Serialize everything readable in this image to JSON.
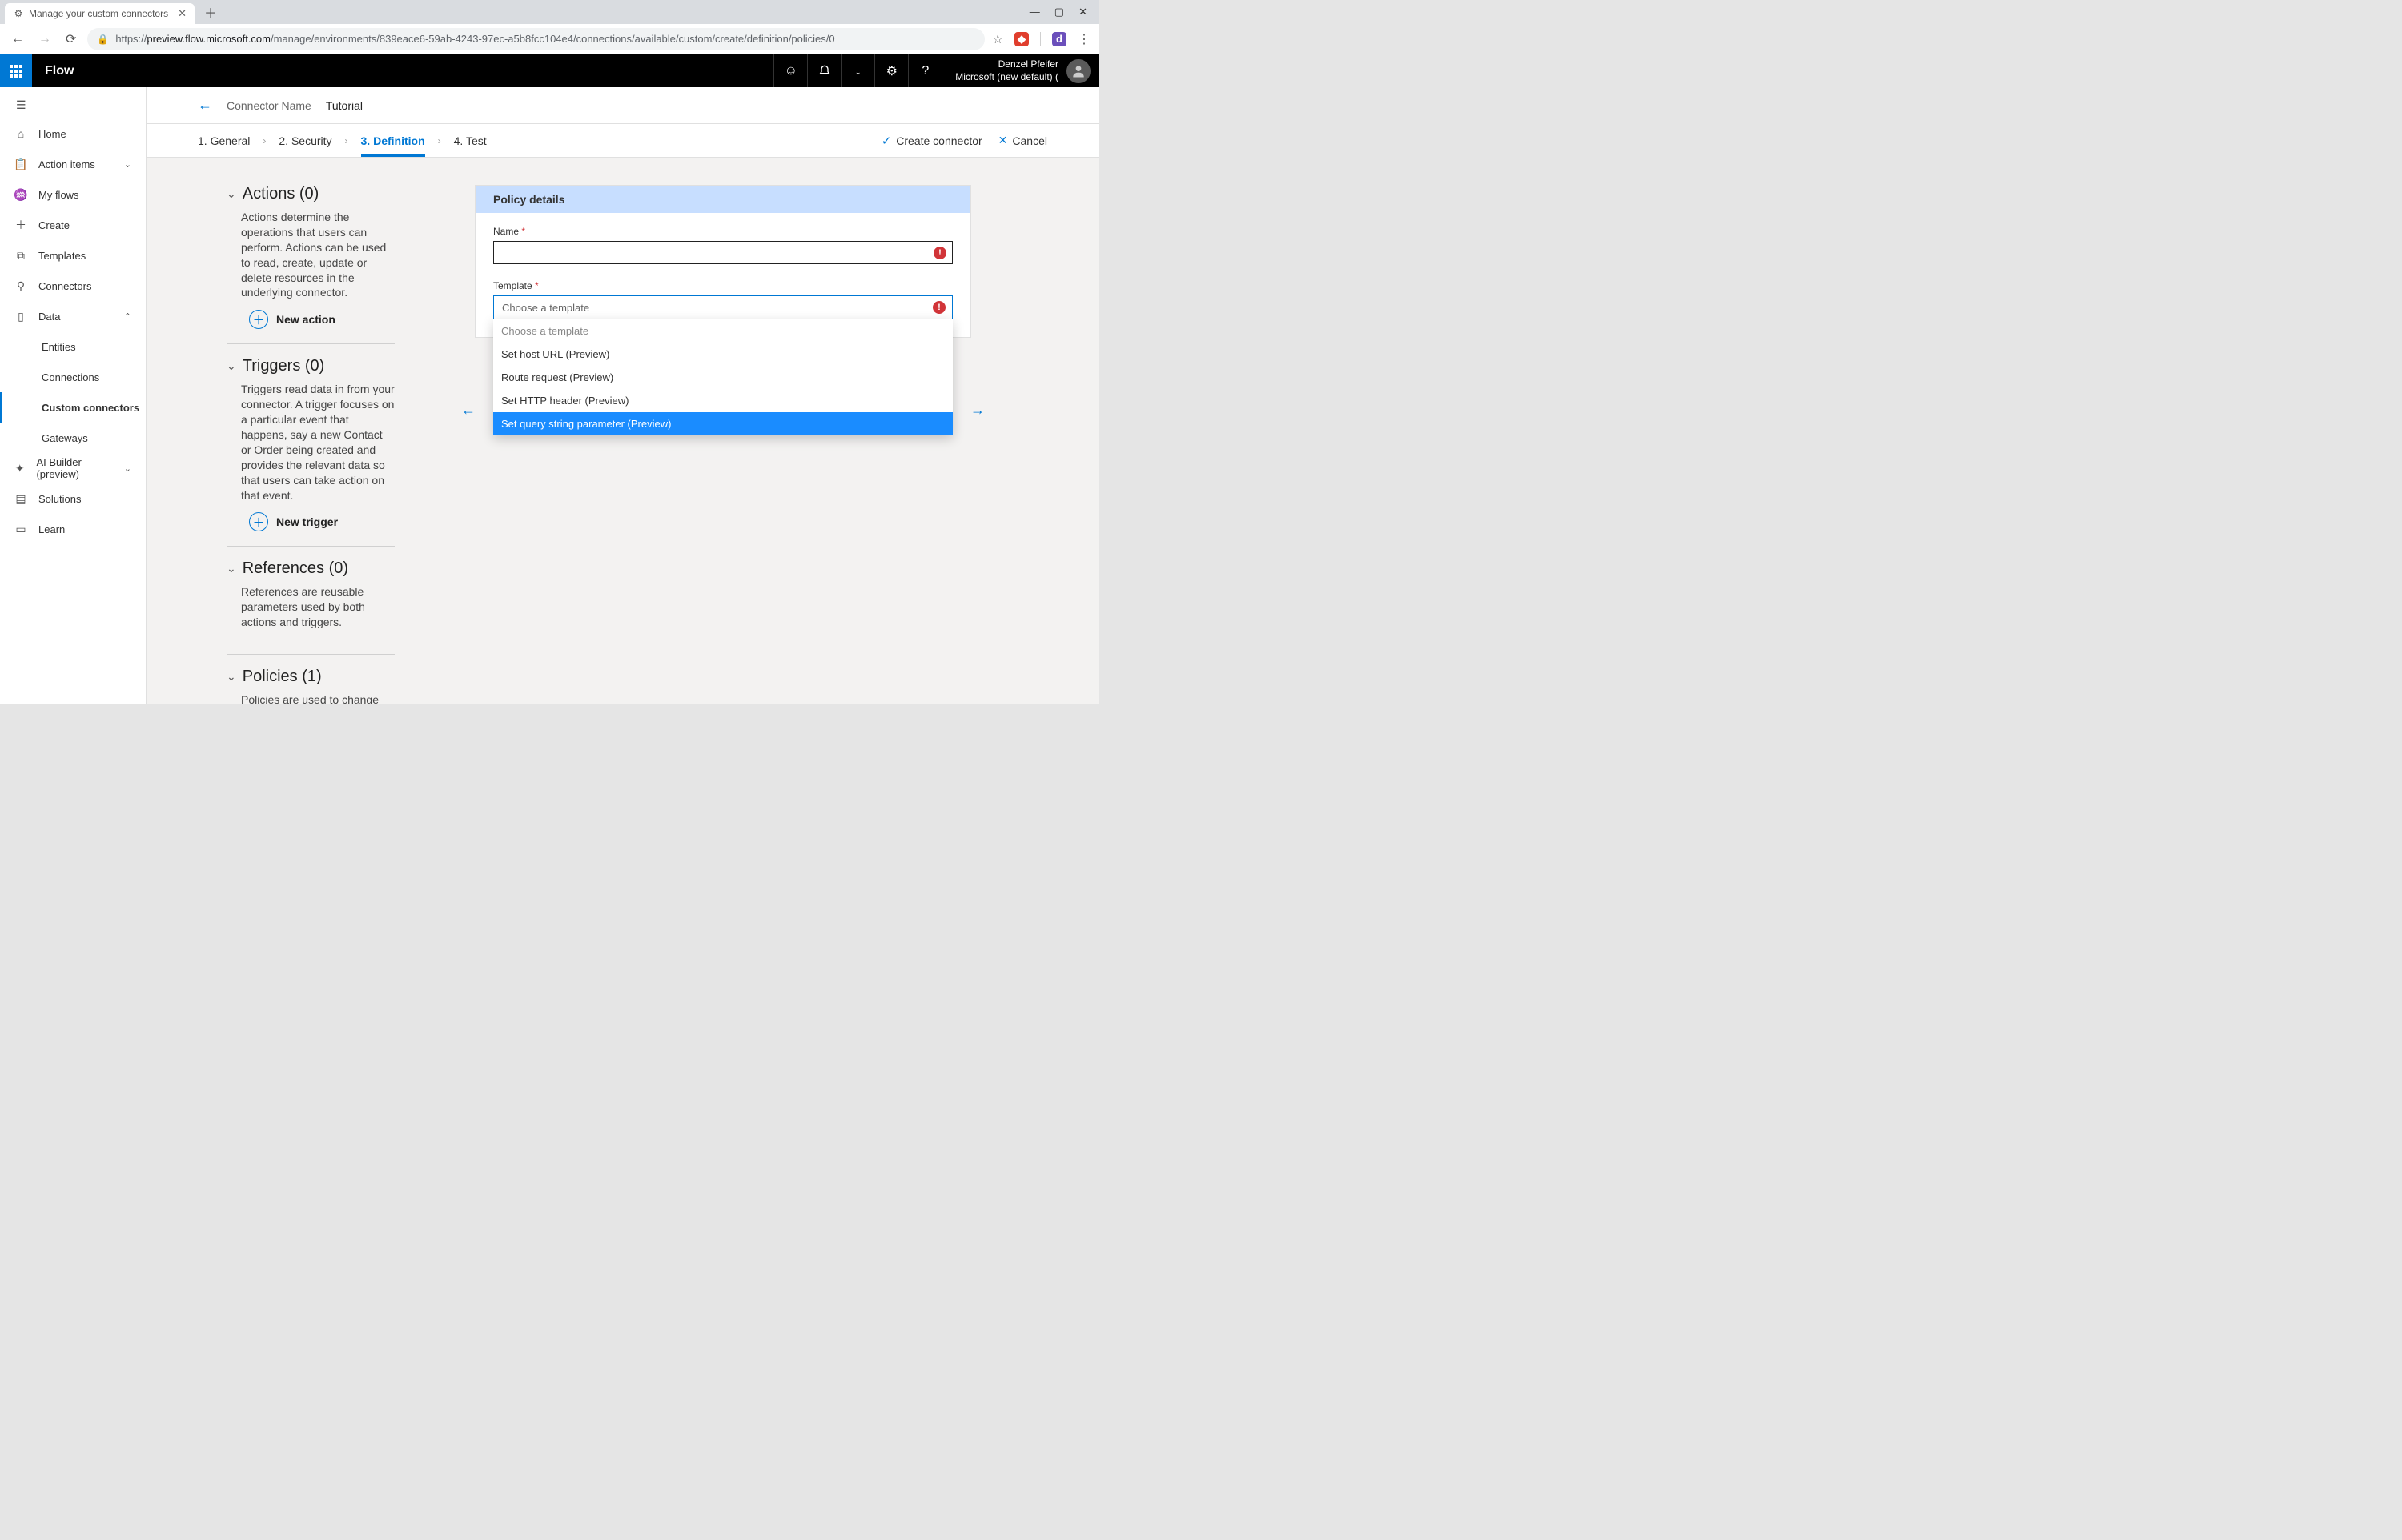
{
  "browser": {
    "tab_title": "Manage your custom connectors",
    "url_prefix": "https://",
    "url_host": "preview.flow.microsoft.com",
    "url_path": "/manage/environments/839eace6-59ab-4243-97ec-a5b8fcc104e4/connections/available/custom/create/definition/policies/0"
  },
  "app": {
    "name": "Flow",
    "user_name": "Denzel Pfeifer",
    "tenant": "Microsoft (new default) ("
  },
  "sidebar": {
    "items": [
      {
        "label": "Home"
      },
      {
        "label": "Action items"
      },
      {
        "label": "My flows"
      },
      {
        "label": "Create"
      },
      {
        "label": "Templates"
      },
      {
        "label": "Connectors"
      },
      {
        "label": "Data"
      }
    ],
    "data_children": [
      {
        "label": "Entities"
      },
      {
        "label": "Connections"
      },
      {
        "label": "Custom connectors"
      },
      {
        "label": "Gateways"
      }
    ],
    "tail": [
      {
        "label": "AI Builder (preview)"
      },
      {
        "label": "Solutions"
      },
      {
        "label": "Learn"
      }
    ]
  },
  "page": {
    "connector_label": "Connector Name",
    "connector_value": "Tutorial",
    "steps": [
      "1. General",
      "2. Security",
      "3. Definition",
      "4. Test"
    ],
    "create": "Create connector",
    "cancel": "Cancel"
  },
  "sections": {
    "actions": {
      "title": "Actions (0)",
      "desc": "Actions determine the operations that users can perform. Actions can be used to read, create, update or delete resources in the underlying connector.",
      "new": "New action"
    },
    "triggers": {
      "title": "Triggers (0)",
      "desc": "Triggers read data in from your connector. A trigger focuses on a particular event that happens, say a new Contact or Order being created and provides the relevant data so that users can take action on that event.",
      "new": "New trigger"
    },
    "references": {
      "title": "References (0)",
      "desc": "References are reusable parameters used by both actions and triggers."
    },
    "policies": {
      "title": "Policies (1)",
      "desc": "Policies are used to change the behavior of actions and triggers through configuration. You can use one or more"
    }
  },
  "policy": {
    "header": "Policy details",
    "name_label": "Name",
    "name_value": "",
    "template_label": "Template",
    "template_selected": "Choose a template",
    "options": [
      "Choose a template",
      "Set host URL (Preview)",
      "Route request (Preview)",
      "Set HTTP header (Preview)",
      "Set query string parameter (Preview)"
    ]
  }
}
